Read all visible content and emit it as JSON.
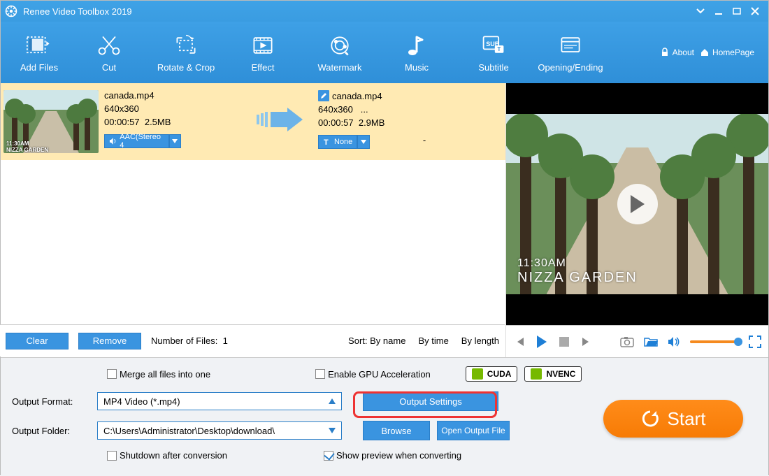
{
  "titlebar": {
    "title": "Renee Video Toolbox 2019"
  },
  "toolbar": {
    "items": [
      {
        "label": "Add Files"
      },
      {
        "label": "Cut"
      },
      {
        "label": "Rotate & Crop"
      },
      {
        "label": "Effect"
      },
      {
        "label": "Watermark"
      },
      {
        "label": "Music"
      },
      {
        "label": "Subtitle"
      },
      {
        "label": "Opening/Ending"
      }
    ],
    "about": "About",
    "homepage": "HomePage"
  },
  "file": {
    "in_name": "canada.mp4",
    "in_res": "640x360",
    "in_dur": "00:00:57",
    "in_size": "2.5MB",
    "audio_dd": "AAC(Stereo 4",
    "out_name": "canada.mp4",
    "out_res": "640x360",
    "out_res_more": "...",
    "out_dur": "00:00:57",
    "out_size": "2.9MB",
    "sub_dd": "None",
    "sub_dash": "-"
  },
  "list_actions": {
    "clear": "Clear",
    "remove": "Remove",
    "count_lbl": "Number of Files:",
    "count_val": "1",
    "sort_lbl": "Sort:",
    "sort_name": "By name",
    "sort_time": "By time",
    "sort_length": "By length"
  },
  "preview": {
    "overlay_time": "11:30AM",
    "overlay_place": "NIZZA GARDEN"
  },
  "bottom": {
    "merge": "Merge all files into one",
    "gpu": "Enable GPU Acceleration",
    "cuda": "CUDA",
    "nvenc": "NVENC",
    "format_lbl": "Output Format:",
    "format_val": "MP4 Video (*.mp4)",
    "output_settings": "Output Settings",
    "folder_lbl": "Output Folder:",
    "folder_val": "C:\\Users\\Administrator\\Desktop\\download\\",
    "browse": "Browse",
    "open_folder": "Open Output File",
    "shutdown": "Shutdown after conversion",
    "show_preview": "Show preview when converting",
    "start": "Start"
  }
}
